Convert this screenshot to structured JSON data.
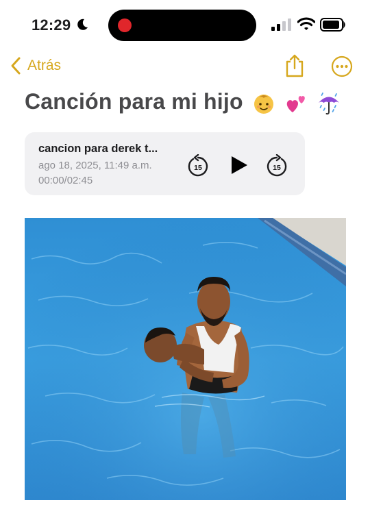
{
  "status_bar": {
    "time": "12:29",
    "focus_icon": "moon-icon",
    "recording_indicator_color": "#e0262b",
    "icons": [
      "signal-icon",
      "wifi-icon",
      "battery-icon"
    ]
  },
  "nav": {
    "back_label": "Atrás",
    "accent_color": "#d6a71d",
    "actions": [
      "share-icon",
      "more-icon"
    ]
  },
  "note": {
    "title": "Canción para mi hijo",
    "title_emojis": [
      "baby-emoji",
      "two-hearts-emoji",
      "umbrella-rain-emoji"
    ]
  },
  "audio": {
    "title": "cancion para derek t...",
    "date": "ago 18, 2025, 11:49 a.m.",
    "duration": "00:00/02:45",
    "skip_back_seconds": "15",
    "skip_forward_seconds": "15",
    "controls": [
      "skip-back-15-icon",
      "play-icon",
      "skip-forward-15-icon"
    ]
  },
  "photo": {
    "subject": "photo-of-man-holding-baby-in-pool"
  }
}
